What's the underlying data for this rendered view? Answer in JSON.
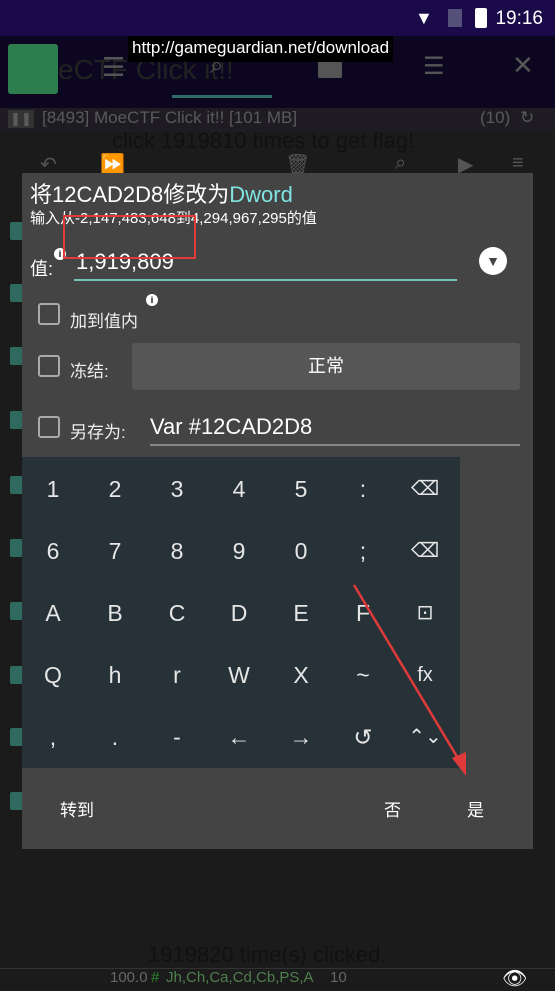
{
  "status": {
    "time": "19:16"
  },
  "url_toast": "http://gameguardian.net/download",
  "background": {
    "app_title": "eCTF Click it!!",
    "process": "[8493] MoeCTF Click it!! [101 MB]",
    "count": "(10)",
    "hint": "click 1919810 times to get flag!",
    "clicked": "1919820 time(s) clicked."
  },
  "dialog": {
    "title_prefix": "将12CAD2D8修改为",
    "title_type": "Dword",
    "range": "输入从-2,147,483,648到4,294,967,295的值",
    "value_label": "值:",
    "value": "1,919,809",
    "add_label": "加到值内",
    "freeze_label": "冻结:",
    "freeze_mode": "正常",
    "saveas_label": "另存为:",
    "saveas_value": "Var #12CAD2D8",
    "keys": [
      [
        "1",
        "2",
        "3",
        "4",
        "5",
        ":",
        "⌫"
      ],
      [
        "6",
        "7",
        "8",
        "9",
        "0",
        ";",
        "⌫"
      ],
      [
        "A",
        "B",
        "C",
        "D",
        "E",
        "F",
        "⊡"
      ],
      [
        "Q",
        "h",
        "r",
        "W",
        "X",
        "~",
        "fx"
      ],
      [
        ",",
        ".",
        "-",
        "←",
        "→",
        "↺",
        "⌃⌄"
      ]
    ],
    "goto": "转到",
    "no": "否",
    "yes": "是"
  },
  "footer": {
    "speed": "100.0",
    "hash": "#",
    "regions": "Jh,Ch,Ca,Cd,Cb,PS,A",
    "num": "10"
  },
  "colors": {
    "accent": "#7fe3e0",
    "highlight": "#e03a3a",
    "dialog": "#444444",
    "keypad": "#263238"
  }
}
